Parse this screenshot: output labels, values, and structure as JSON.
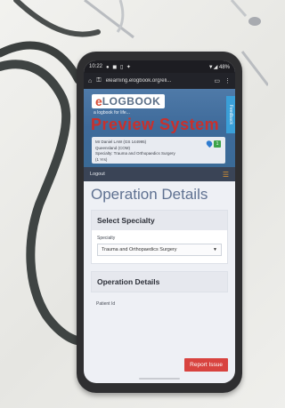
{
  "status": {
    "time": "10:22",
    "right": "▼◢ 48%"
  },
  "browser": {
    "url": "elearning.elogbook.org/eli..."
  },
  "brand": {
    "logo_e": "e",
    "logo_rest": "LOGBOOK",
    "tagline": "a logbook for life...",
    "banner": "Preview System",
    "side_tab": "Feedback"
  },
  "user": {
    "name": "Mr Daniel LAW (GS 144995)",
    "org": "Queensland (COM)",
    "specialty": "Specialty: Trauma and Orthopaedics Surgery",
    "extra": "(1 Yrs)",
    "badge_count": "1"
  },
  "nav": {
    "logout": "Logout"
  },
  "page": {
    "title": "Operation Details",
    "select_specialty_heading": "Select Specialty",
    "specialty_label": "Specialty",
    "specialty_value": "Trauma and Orthopaedics Surgery",
    "operation_heading": "Operation Details",
    "patient_id_label": "Patient Id",
    "report_button": "Report Issue"
  },
  "colors": {
    "header_blue": "#3e6a9a",
    "banner_red": "#c9302c",
    "report_red": "#d8433f",
    "phone_case": "#2f2f31"
  }
}
